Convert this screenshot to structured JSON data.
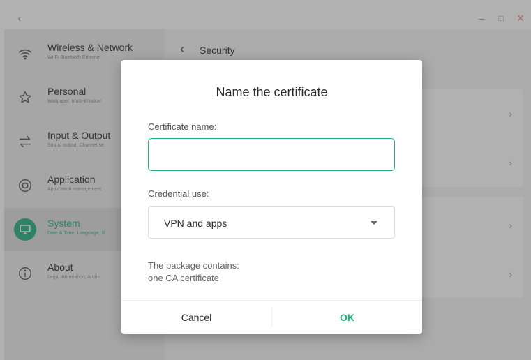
{
  "titlebar": {
    "back_icon": "chevron-left-icon",
    "minimize_icon": "minimize-icon",
    "maximize_icon": "maximize-icon",
    "close_icon": "close-icon"
  },
  "sidebar": {
    "items": [
      {
        "title": "Wireless & Network",
        "subtitle": "Wi-Fi Bluetooth Ethernet",
        "icon": "wifi-icon"
      },
      {
        "title": "Personal",
        "subtitle": "Wallpaper, Multi-Window",
        "icon": "star-icon"
      },
      {
        "title": "Input & Output",
        "subtitle": "Sound output, Channel se",
        "icon": "swap-arrows-icon"
      },
      {
        "title": "Application",
        "subtitle": "Application management",
        "icon": "cube-icon"
      },
      {
        "title": "System",
        "subtitle": "Date & Time, Language, S",
        "icon": "monitor-icon",
        "active": true
      },
      {
        "title": "About",
        "subtitle": "Legal information, Andro",
        "icon": "info-icon"
      }
    ]
  },
  "main": {
    "title": "Security",
    "back_icon": "chevron-left-icon"
  },
  "dialog": {
    "title": "Name the certificate",
    "name_label": "Certificate name:",
    "name_value": "",
    "credential_label": "Credential use:",
    "credential_value": "VPN and apps",
    "package_info_line1": "The package contains:",
    "package_info_line2": "one CA certificate",
    "cancel_label": "Cancel",
    "ok_label": "OK"
  },
  "colors": {
    "accent": "#1fae7e",
    "sidebar_bg": "#ececec",
    "overlay": "rgba(70,70,70,0.42)"
  }
}
